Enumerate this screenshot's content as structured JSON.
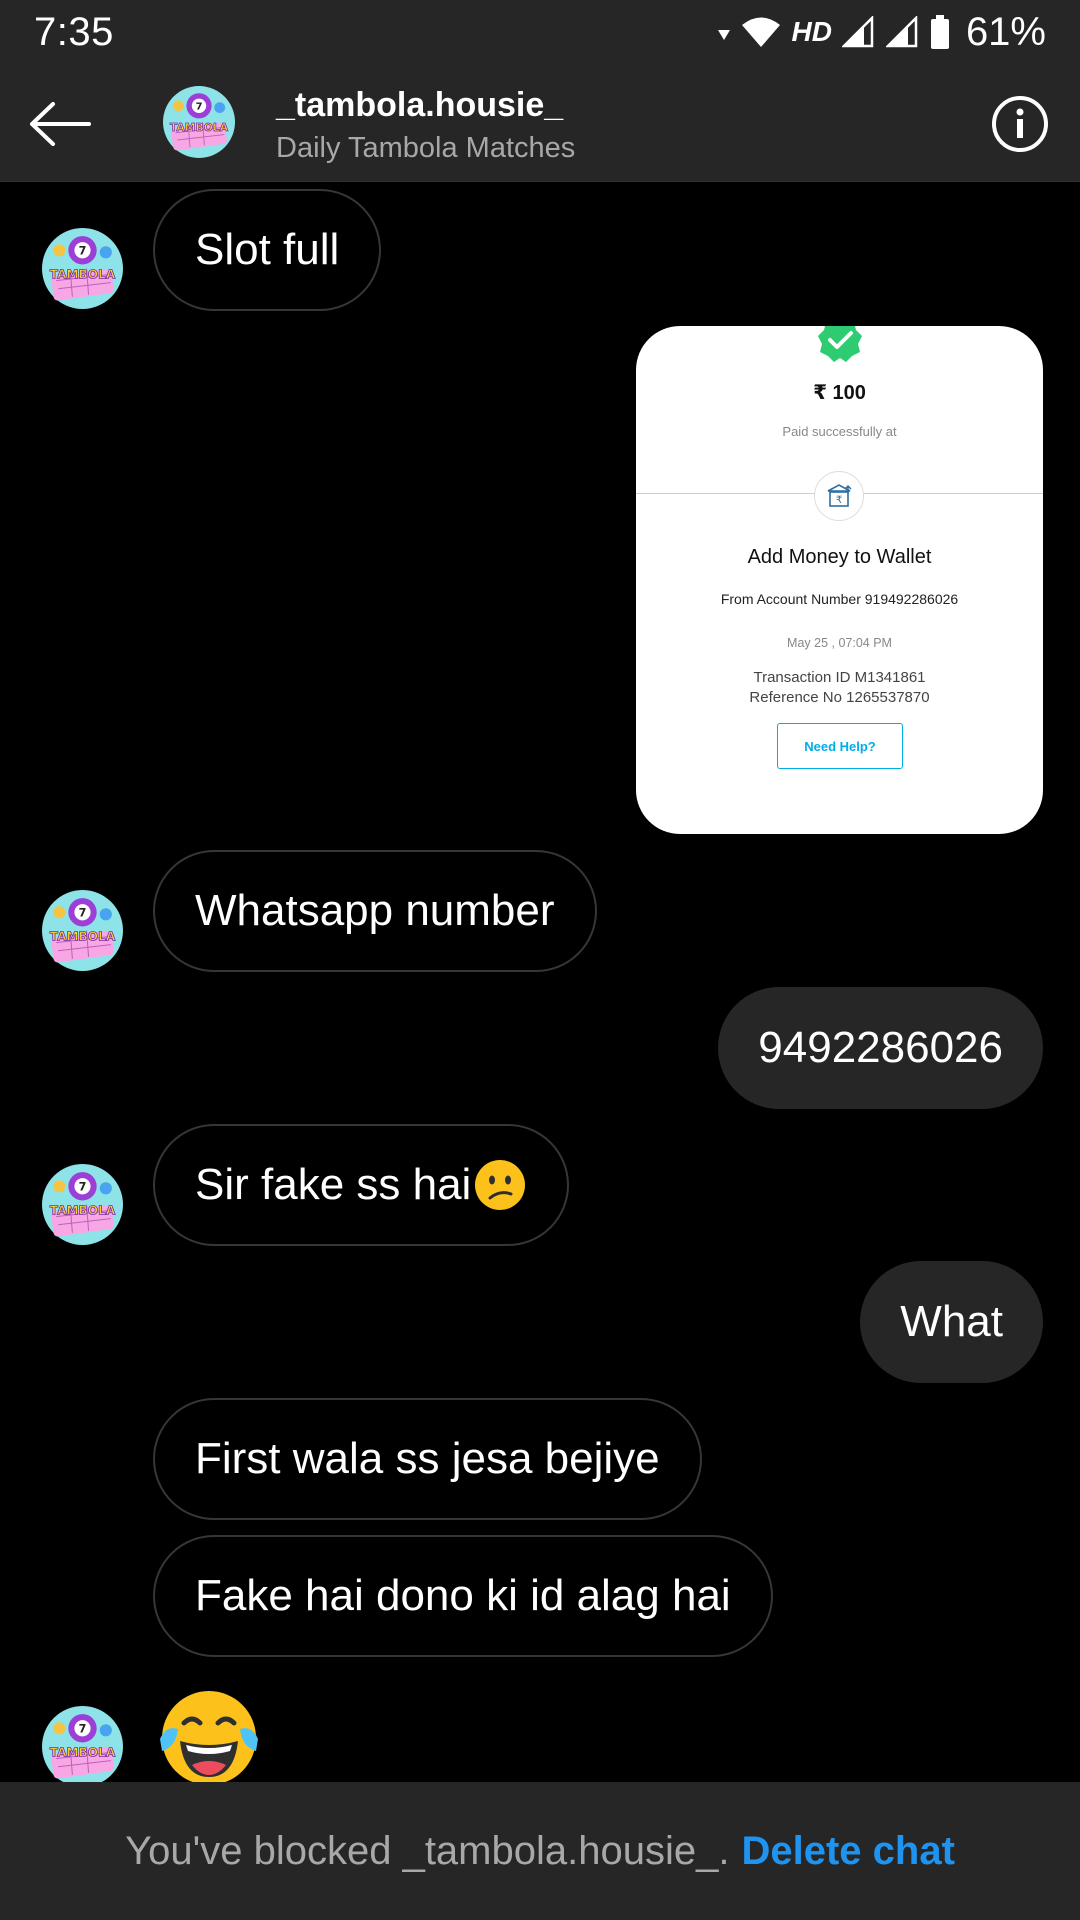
{
  "status_bar": {
    "time": "7:35",
    "network_label": "HD",
    "battery": "61%"
  },
  "header": {
    "title": "_tambola.housie_",
    "subtitle": "Daily Tambola Matches",
    "avatar_text": "TAMBOLA"
  },
  "messages": [
    {
      "from": "them",
      "text": "Slot full"
    },
    {
      "from": "me",
      "type": "image"
    },
    {
      "from": "them",
      "text": "Whatsapp number"
    },
    {
      "from": "me",
      "text": "9492286026"
    },
    {
      "from": "them",
      "text": "Sir fake ss hai",
      "emoji": "confused-face"
    },
    {
      "from": "me",
      "text": "What"
    },
    {
      "from": "them",
      "text": "First wala ss jesa bejiye"
    },
    {
      "from": "them",
      "text": "Fake hai dono ki id alag hai"
    },
    {
      "from": "them",
      "emoji": "face-with-tears-of-joy"
    }
  ],
  "receipt": {
    "amount": "₹ 100",
    "paid_text": "Paid successfully at",
    "title": "Add Money to Wallet",
    "account": "From Account Number 919492286026",
    "date": "May 25 , 07:04 PM",
    "transaction": "Transaction ID M1341861",
    "reference": "Reference No 1265537870",
    "help_label": "Need Help?"
  },
  "footer": {
    "blocked_text": "You've blocked _tambola.housie_.",
    "delete_label": "Delete chat"
  },
  "colors": {
    "background": "#000000",
    "bar": "#262626",
    "link": "#1e94f0",
    "receipt_accent": "#00aee8",
    "check": "#2ecc71"
  }
}
